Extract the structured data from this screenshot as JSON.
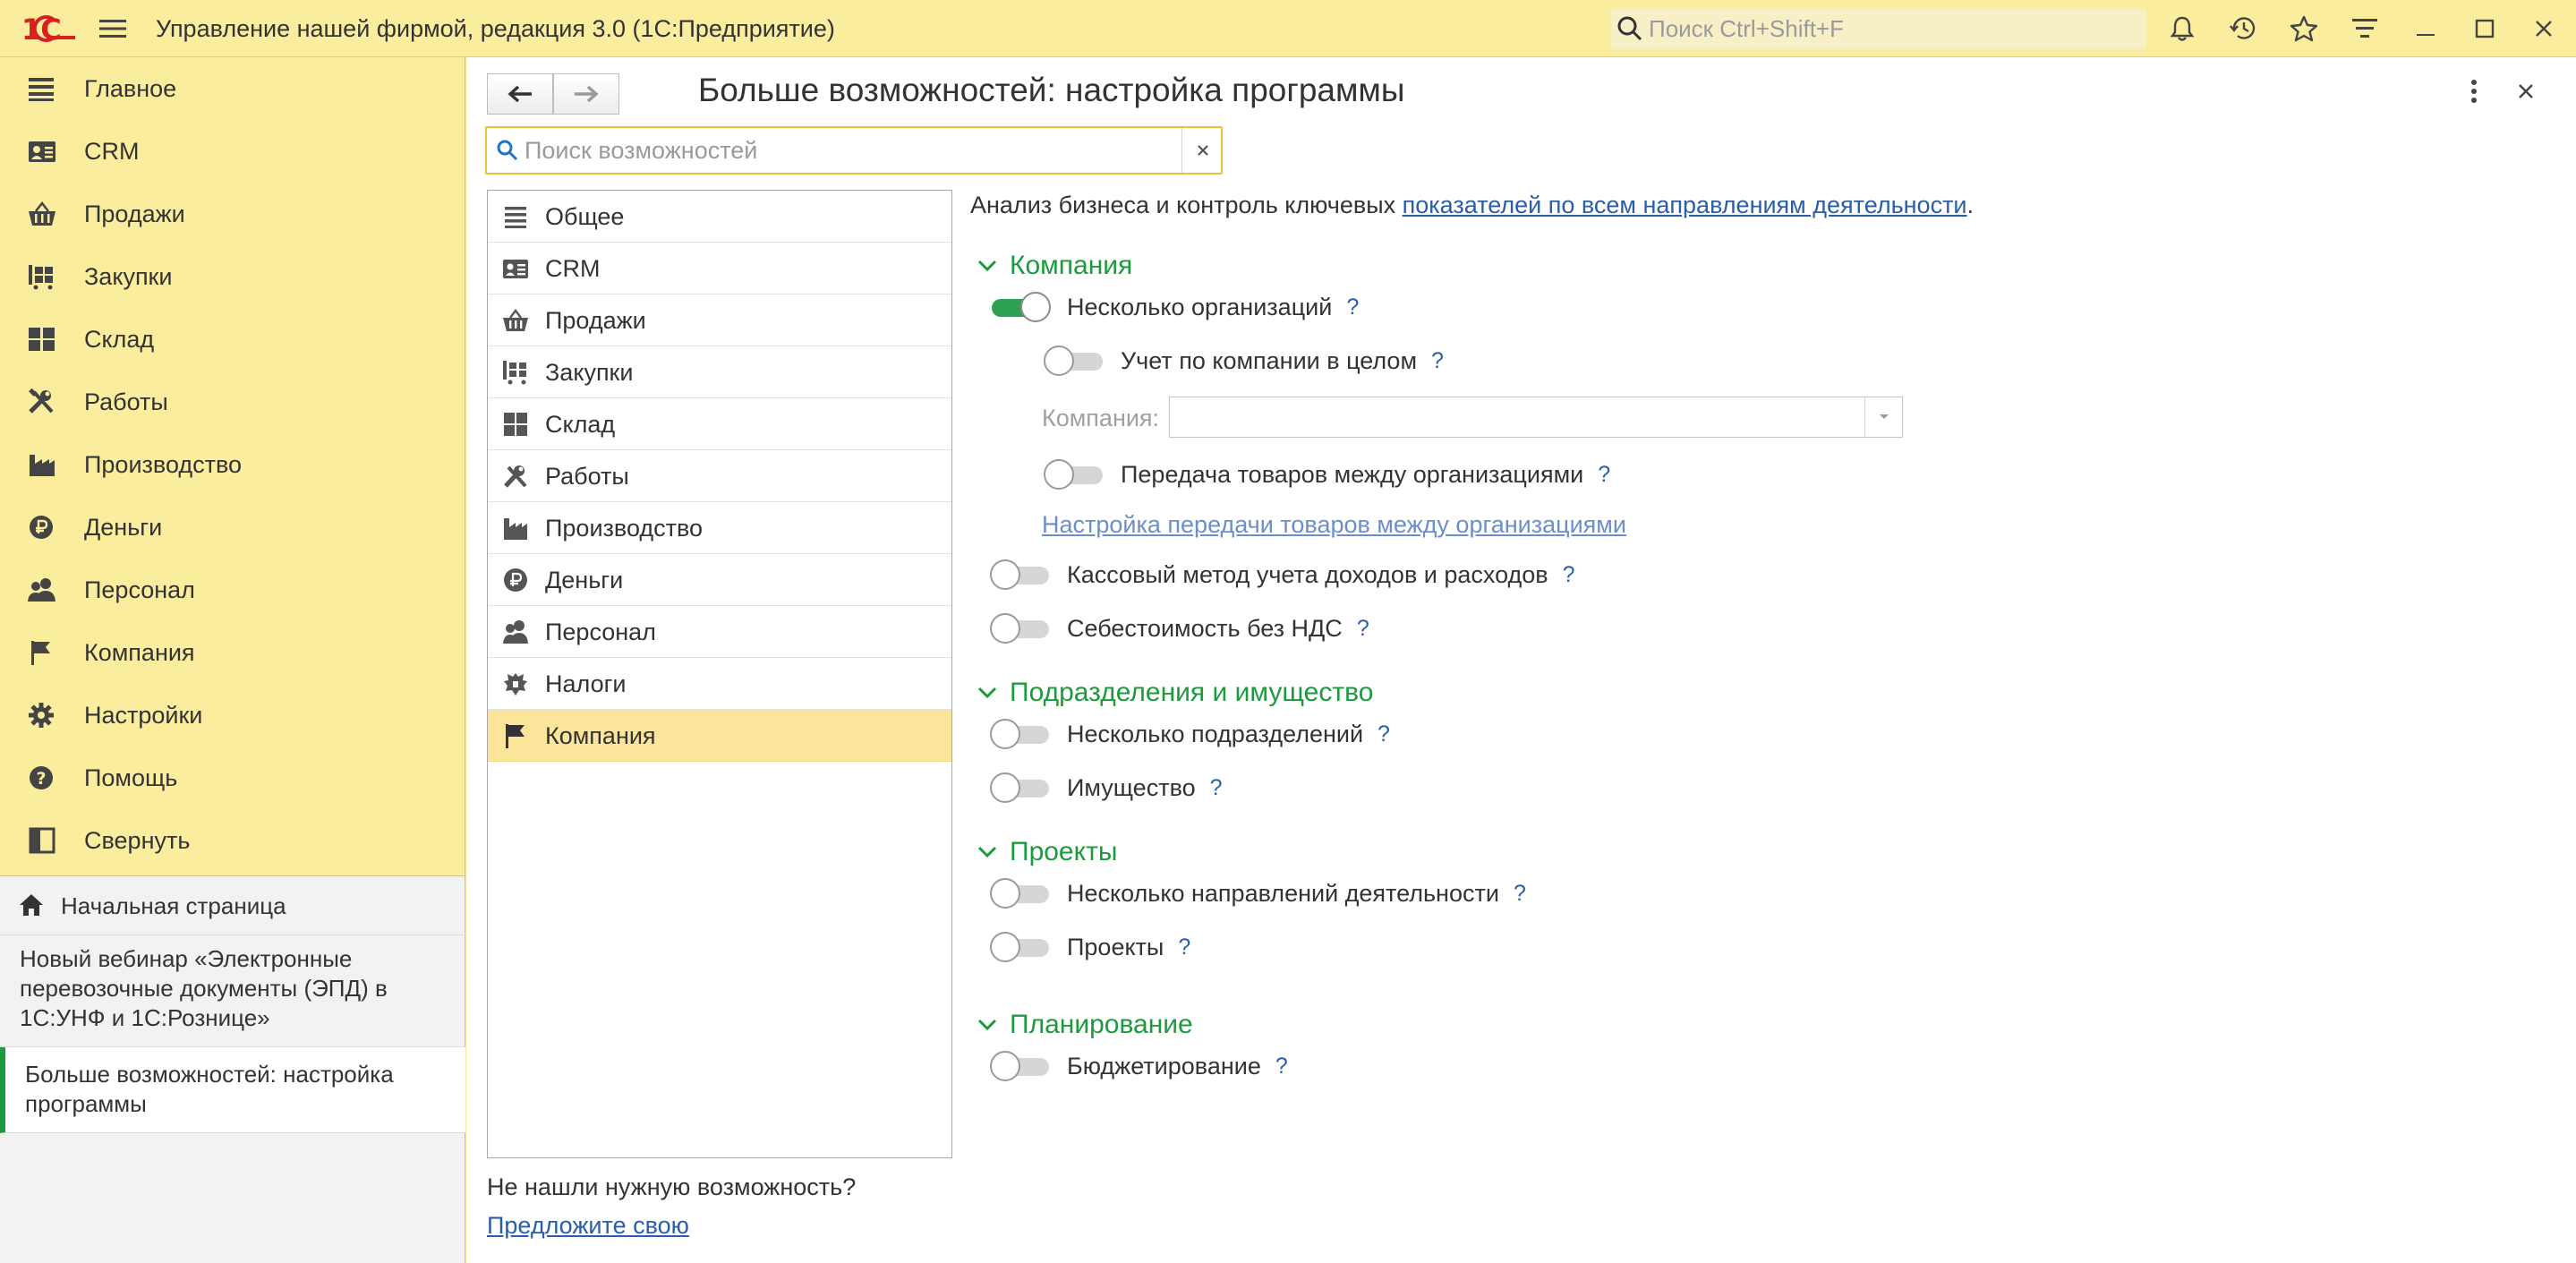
{
  "app": {
    "title": "Управление нашей фирмой, редакция 3.0  (1С:Предприятие)",
    "logo": "1С",
    "search_placeholder": "Поиск Ctrl+Shift+F"
  },
  "nav": {
    "items": [
      {
        "label": "Главное",
        "icon": "list-icon"
      },
      {
        "label": "CRM",
        "icon": "contact-card-icon"
      },
      {
        "label": "Продажи",
        "icon": "basket-icon"
      },
      {
        "label": "Закупки",
        "icon": "cart-icon"
      },
      {
        "label": "Склад",
        "icon": "warehouse-icon"
      },
      {
        "label": "Работы",
        "icon": "tools-icon"
      },
      {
        "label": "Производство",
        "icon": "factory-icon"
      },
      {
        "label": "Деньги",
        "icon": "ruble-icon"
      },
      {
        "label": "Персонал",
        "icon": "people-icon"
      },
      {
        "label": "Компания",
        "icon": "flag-icon"
      },
      {
        "label": "Настройки",
        "icon": "gear-icon"
      },
      {
        "label": "Помощь",
        "icon": "help-icon"
      },
      {
        "label": "Свернуть",
        "icon": "collapse-icon"
      }
    ]
  },
  "open_windows": {
    "home": "Начальная страница",
    "webinar": "Новый вебинар «Электронные перевозочные документы (ЭПД) в 1С:УНФ и 1С:Рознице»",
    "current": "Больше возможностей: настройка программы"
  },
  "form": {
    "title": "Больше возможностей: настройка программы",
    "search_placeholder": "Поиск возможностей",
    "sections": [
      "Общее",
      "CRM",
      "Продажи",
      "Закупки",
      "Склад",
      "Работы",
      "Производство",
      "Деньги",
      "Персонал",
      "Налоги",
      "Компания"
    ],
    "selected_section": "Компания",
    "not_found": "Не нашли нужную возможность?",
    "suggest_link": "Предложите свою",
    "intro_text": "Анализ бизнеса и контроль ключевых ",
    "intro_link": "показателей по всем направлениям деятельности",
    "intro_end": ".",
    "groups": {
      "company": {
        "title": "Компания",
        "several_orgs": "Несколько организаций",
        "accounting_whole": "Учет по компании в целом",
        "company_label": "Компания:",
        "company_value": "",
        "transfer": "Передача товаров между организациями",
        "transfer_link": "Настройка передачи товаров между организациями",
        "cash_method": "Кассовый метод учета доходов и расходов",
        "cost_no_vat": "Себестоимость без НДС"
      },
      "departments": {
        "title": "Подразделения и имущество",
        "several_depts": "Несколько подразделений",
        "property": "Имущество"
      },
      "projects": {
        "title": "Проекты",
        "several_directions": "Несколько направлений деятельности",
        "projects": "Проекты"
      },
      "planning": {
        "title": "Планирование",
        "budgeting": "Бюджетирование"
      }
    },
    "help_mark": "?"
  },
  "colors": {
    "accent_yellow": "#fbed9e",
    "section_green": "#1d9a3e",
    "toggle_on": "#2ea052",
    "link_blue": "#2a5fa8",
    "logo_red": "#d8201f"
  }
}
